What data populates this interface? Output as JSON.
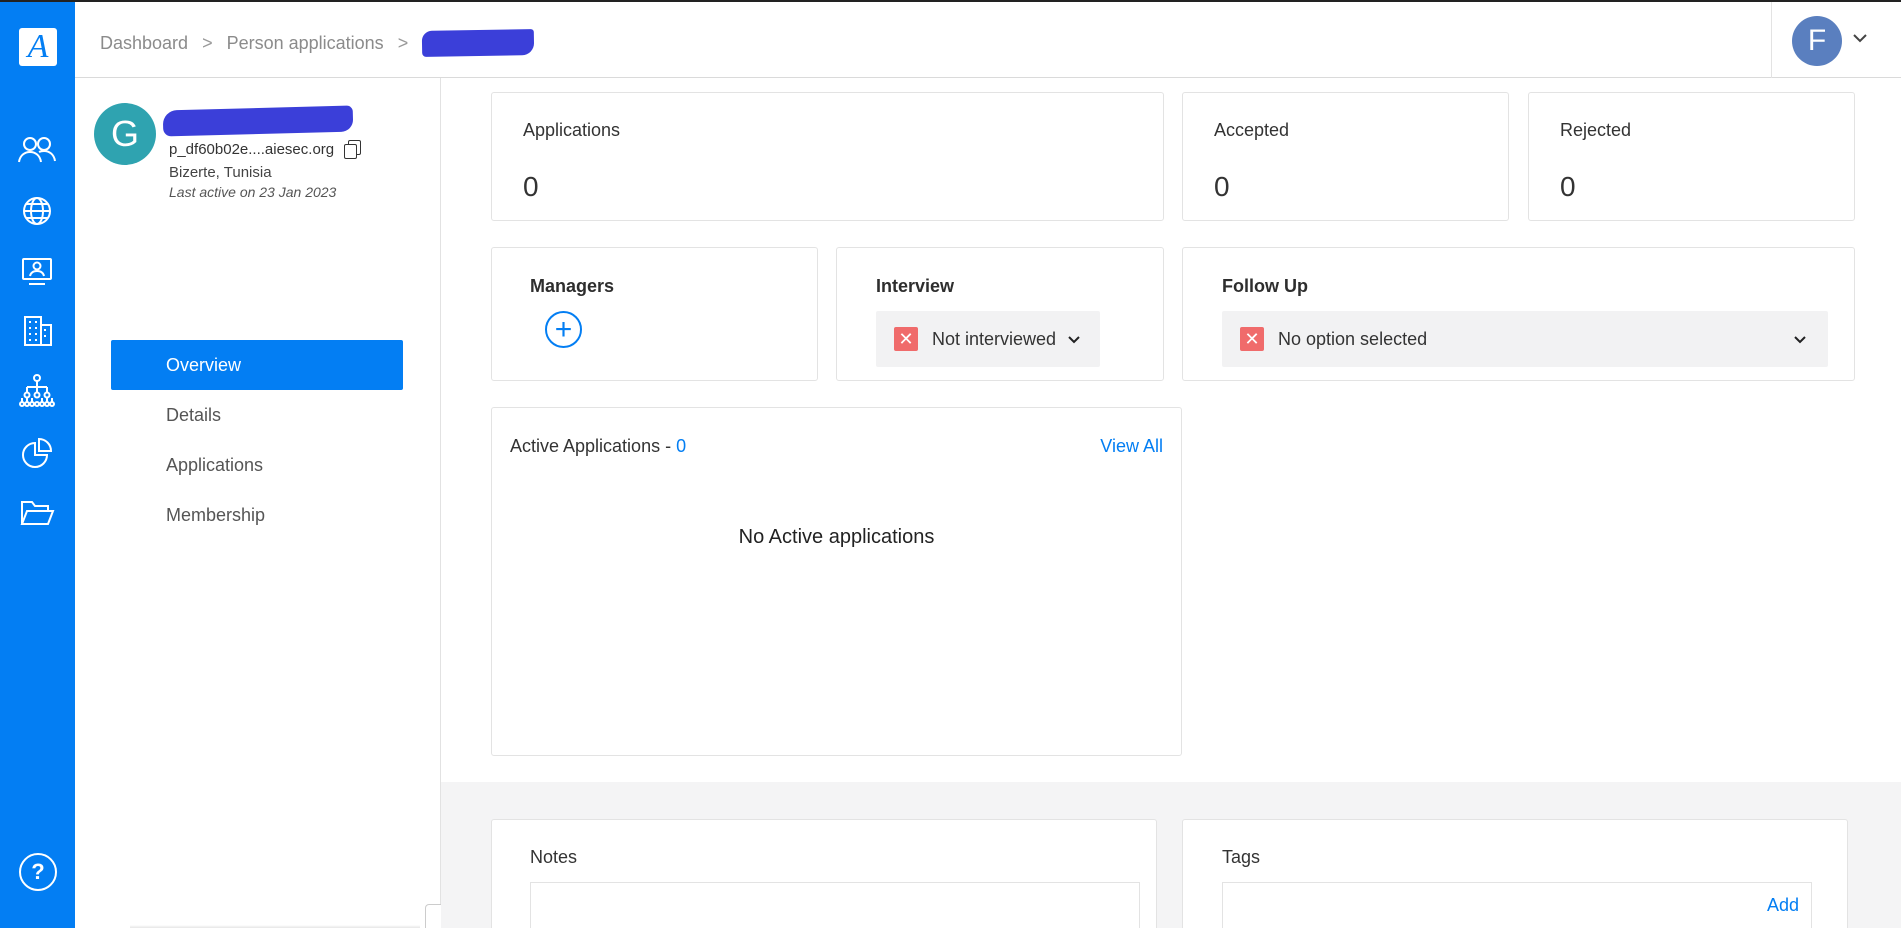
{
  "rail": {
    "logo_letter": "A",
    "icons": [
      "people-icon",
      "globe-icon",
      "monitor-user-icon",
      "building-icon",
      "org-tree-icon",
      "pie-chart-icon",
      "folder-open-icon"
    ],
    "help_glyph": "?"
  },
  "breadcrumb": {
    "items": [
      "Dashboard",
      "Person applications"
    ],
    "separator": ">"
  },
  "user": {
    "initial": "F"
  },
  "profile": {
    "initial": "G",
    "email": "p_df60b02e....aiesec.org",
    "location": "Bizerte, Tunisia",
    "last_active": "Last active on 23 Jan 2023"
  },
  "menu": {
    "items": [
      "Overview",
      "Details",
      "Applications",
      "Membership"
    ],
    "active": "Overview"
  },
  "stats": {
    "applications": {
      "label": "Applications",
      "value": "0"
    },
    "accepted": {
      "label": "Accepted",
      "value": "0"
    },
    "rejected": {
      "label": "Rejected",
      "value": "0"
    }
  },
  "managers": {
    "label": "Managers",
    "add_glyph": "+"
  },
  "interview": {
    "label": "Interview",
    "value": "Not interviewed"
  },
  "follow_up": {
    "label": "Follow Up",
    "value": "No option selected"
  },
  "active_applications": {
    "title": "Active Applications - ",
    "count": "0",
    "view_all": "View All",
    "empty_text": "No Active applications"
  },
  "notes": {
    "label": "Notes"
  },
  "tags": {
    "label": "Tags",
    "add": "Add"
  },
  "colors": {
    "accent": "#037ef3",
    "avatar_g": "#2fa3b0",
    "avatar_f": "#5a7fbf",
    "status_red": "#f06b6b"
  }
}
